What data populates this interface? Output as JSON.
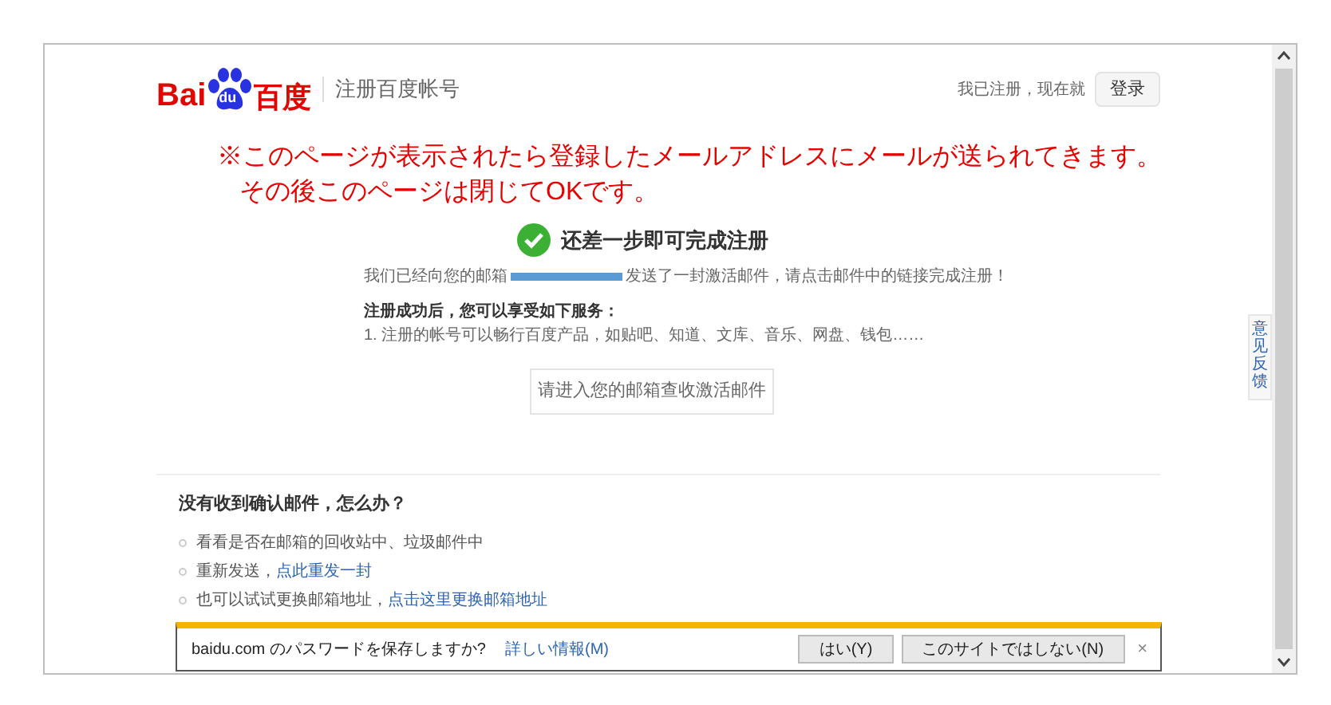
{
  "header": {
    "logo": {
      "prefix": "Bai",
      "mark": "du",
      "suffix": "百度"
    },
    "title": "注册百度帐号",
    "login_prompt": "我已注册，现在就",
    "login_button": "登录"
  },
  "annotation": [
    "※このページが表示されたら登録したメールアドレスにメールが送られてきます。",
    "その後このページは閉じてOKです。"
  ],
  "status": {
    "title": "还差一步即可完成注册",
    "message_before": "我们已经向您的邮箱",
    "message_after": "发送了一封激活邮件，请点击邮件中的链接完成注册！",
    "benefits_title": "注册成功后，您可以享受如下服务：",
    "benefits": [
      "1. 注册的帐号可以畅行百度产品，如贴吧、知道、文库、音乐、网盘、钱包……"
    ],
    "button": "请进入您的邮箱查收激活邮件"
  },
  "help": {
    "title": "没有收到确认邮件，怎么办？",
    "items": [
      {
        "text": "看看是否在邮箱的回收站中、垃圾邮件中"
      },
      {
        "text": "重新发送，",
        "link": "点此重发一封"
      },
      {
        "text": "也可以试试更换邮箱地址，",
        "link": "点击这里更换邮箱地址"
      }
    ]
  },
  "feedback_tab": "意见反馈",
  "password_bar": {
    "message": "baidu.com のパスワードを保存しますか?",
    "link": "詳しい情報(M)",
    "buttons": [
      "はい(Y)",
      "このサイトではしない(N)"
    ],
    "close": "×"
  }
}
